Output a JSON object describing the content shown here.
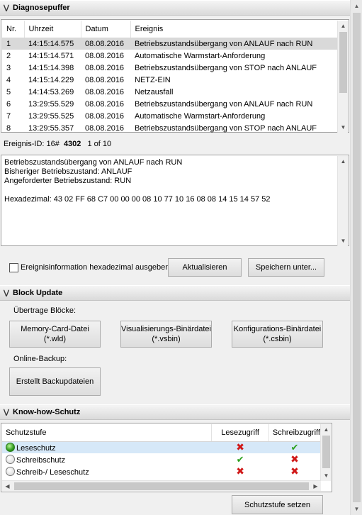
{
  "diag": {
    "header": "Diagnosepuffer",
    "columns": [
      "Nr.",
      "Uhrzeit",
      "Datum",
      "Ereignis"
    ],
    "rows": [
      [
        "1",
        "14:15:14.575",
        "08.08.2016",
        "Betriebszustandsübergang von ANLAUF nach RUN"
      ],
      [
        "2",
        "14:15:14.571",
        "08.08.2016",
        "Automatische Warmstart-Anforderung"
      ],
      [
        "3",
        "14:15:14.398",
        "08.08.2016",
        "Betriebszustandsübergang von STOP nach ANLAUF"
      ],
      [
        "4",
        "14:15:14.229",
        "08.08.2016",
        "NETZ-EIN"
      ],
      [
        "5",
        "14:14:53.269",
        "08.08.2016",
        "Netzausfall"
      ],
      [
        "6",
        "13:29:55.529",
        "08.08.2016",
        "Betriebszustandsübergang von ANLAUF nach RUN"
      ],
      [
        "7",
        "13:29:55.525",
        "08.08.2016",
        "Automatische Warmstart-Anforderung"
      ],
      [
        "8",
        "13:29:55.357",
        "08.08.2016",
        "Betriebszustandsübergang von STOP nach ANLAUF"
      ]
    ],
    "event_id_label": "Ereignis-ID: 16#",
    "event_id_value": "4302",
    "event_position": "1 of 10",
    "detail_lines": [
      "Betriebszustandsübergang von ANLAUF nach RUN",
      "Bisheriger Betriebszustand: ANLAUF",
      "Angeforderter Betriebszustand: RUN",
      "",
      "Hexadezimal: 43 02 FF 68 C7 00 00 00 08 10 77 10 16 08 08 14 15 14 57 52"
    ],
    "hex_checkbox_label": "Ereignisinformation hexadezimal ausgeben",
    "refresh_button": "Aktualisieren",
    "save_button": "Speichern unter..."
  },
  "block": {
    "header": "Block Update",
    "transfer_label": "Übertrage Blöcke:",
    "btn_memory_l1": "Memory-Card-Datei",
    "btn_memory_l2": "(*.wld)",
    "btn_vis_l1": "Visualisierungs-Binärdatei",
    "btn_vis_l2": "(*.vsbin)",
    "btn_conf_l1": "Konfigurations-Binärdatei",
    "btn_conf_l2": "(*.csbin)",
    "backup_label": "Online-Backup:",
    "btn_backup": "Erstellt Backupdateien"
  },
  "knowhow": {
    "header": "Know-how-Schutz",
    "columns": [
      "Schutzstufe",
      "Lesezugriff",
      "Schreibzugriff"
    ],
    "rows": [
      {
        "name": "Leseschutz",
        "read": "no",
        "write": "yes",
        "active": true
      },
      {
        "name": "Schreibschutz",
        "read": "yes",
        "write": "no",
        "active": false
      },
      {
        "name": "Schreib-/ Leseschutz",
        "read": "no",
        "write": "no",
        "active": false
      }
    ],
    "set_button": "Schutzstufe setzen"
  },
  "colors": {
    "selection_gray": "#d9d9d9",
    "selection_blue": "#d6e8f8",
    "deny_red": "#d01818",
    "allow_green": "#2ba01c"
  }
}
